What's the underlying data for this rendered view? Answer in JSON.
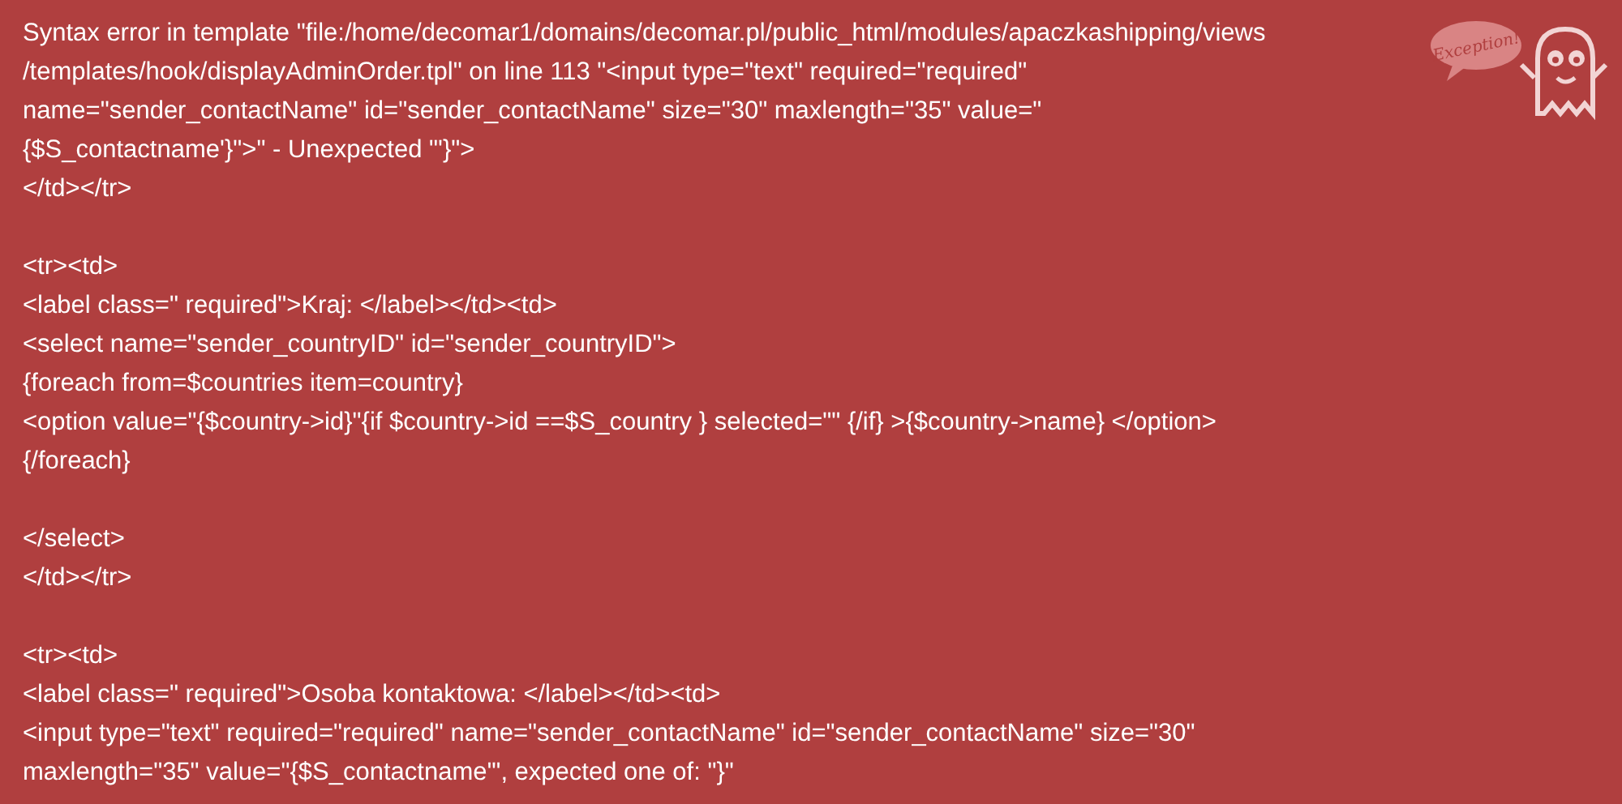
{
  "error_blocks": [
    {
      "lines": [
        "Syntax error in template \"file:/home/decomar1/domains/decomar.pl/public_html/modules/apaczkashipping/views",
        "/templates/hook/displayAdminOrder.tpl\" on line 113 \"<input type=\"text\" required=\"required\"",
        "name=\"sender_contactName\" id=\"sender_contactName\" size=\"30\" maxlength=\"35\" value=\"",
        "{$S_contactname'}\">\" - Unexpected \"'}\">",
        "</td></tr>"
      ]
    },
    {
      "lines": [
        "<tr><td>",
        "<label class=\" required\">Kraj: </label></td><td>",
        "<select name=\"sender_countryID\" id=\"sender_countryID\">",
        "{foreach from=$countries item=country}",
        "<option value=\"{$country->id}\"{if $country->id ==$S_country } selected=\"\" {/if} >{$country->name} </option>",
        "{/foreach}"
      ]
    },
    {
      "lines": [
        "</select>",
        "</td></tr>"
      ]
    },
    {
      "lines": [
        "<tr><td>",
        "<label class=\" required\">Osoba kontaktowa: </label></td><td>",
        "<input type=\"text\" required=\"required\" name=\"sender_contactName\" id=\"sender_contactName\" size=\"30\"",
        "maxlength=\"35\" value=\"{$S_contactname'\", expected one of: \"}\""
      ]
    }
  ],
  "mascot": {
    "bubble_text": "Exception!"
  }
}
